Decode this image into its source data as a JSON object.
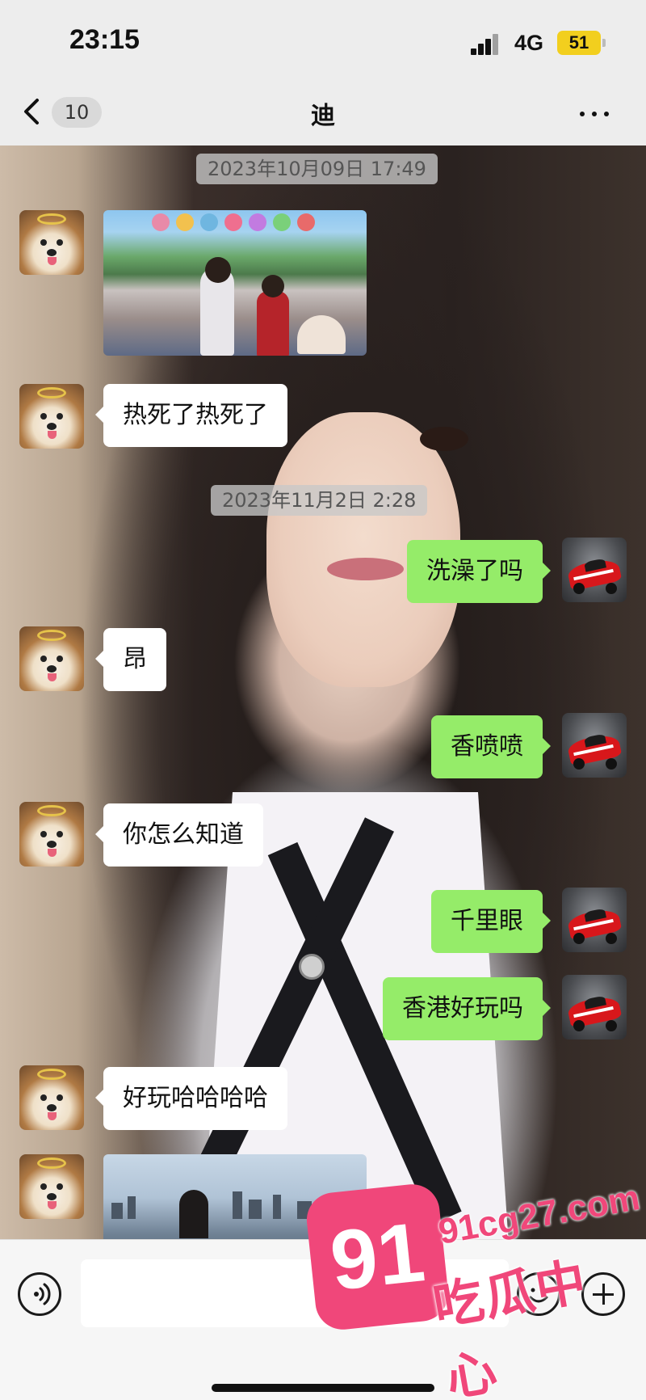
{
  "status_bar": {
    "time": "23:15",
    "network": "4G",
    "battery": "51"
  },
  "nav": {
    "unread_count": "10",
    "title": "迪",
    "back_icon": "chevron-left-icon",
    "more_icon": "more-horizontal-icon"
  },
  "chat": {
    "timestamps": [
      "2023年10月09日 17:49",
      "2023年11月2日 2:28"
    ],
    "messages": [
      {
        "side": "in",
        "type": "image"
      },
      {
        "side": "in",
        "type": "text",
        "text": "热死了热死了"
      },
      {
        "side": "out",
        "type": "text",
        "text": "洗澡了吗"
      },
      {
        "side": "in",
        "type": "text",
        "text": "昂"
      },
      {
        "side": "out",
        "type": "text",
        "text": "香喷喷"
      },
      {
        "side": "in",
        "type": "text",
        "text": "你怎么知道"
      },
      {
        "side": "out",
        "type": "text",
        "text": "千里眼"
      },
      {
        "side": "out",
        "type": "text",
        "text": "香港好玩吗"
      },
      {
        "side": "in",
        "type": "text",
        "text": "好玩哈哈哈哈"
      },
      {
        "side": "in",
        "type": "image"
      }
    ]
  },
  "input_bar": {
    "voice_icon": "voice-icon",
    "emoji_icon": "emoji-icon",
    "plus_icon": "plus-icon",
    "placeholder": ""
  },
  "watermark": {
    "logo_text": "91",
    "domain": "91cg27.com",
    "name": "吃瓜中心"
  },
  "colors": {
    "outgoing_bubble": "#95ec69",
    "incoming_bubble": "#ffffff",
    "watermark": "#f0477a",
    "battery": "#f2cf1e"
  }
}
